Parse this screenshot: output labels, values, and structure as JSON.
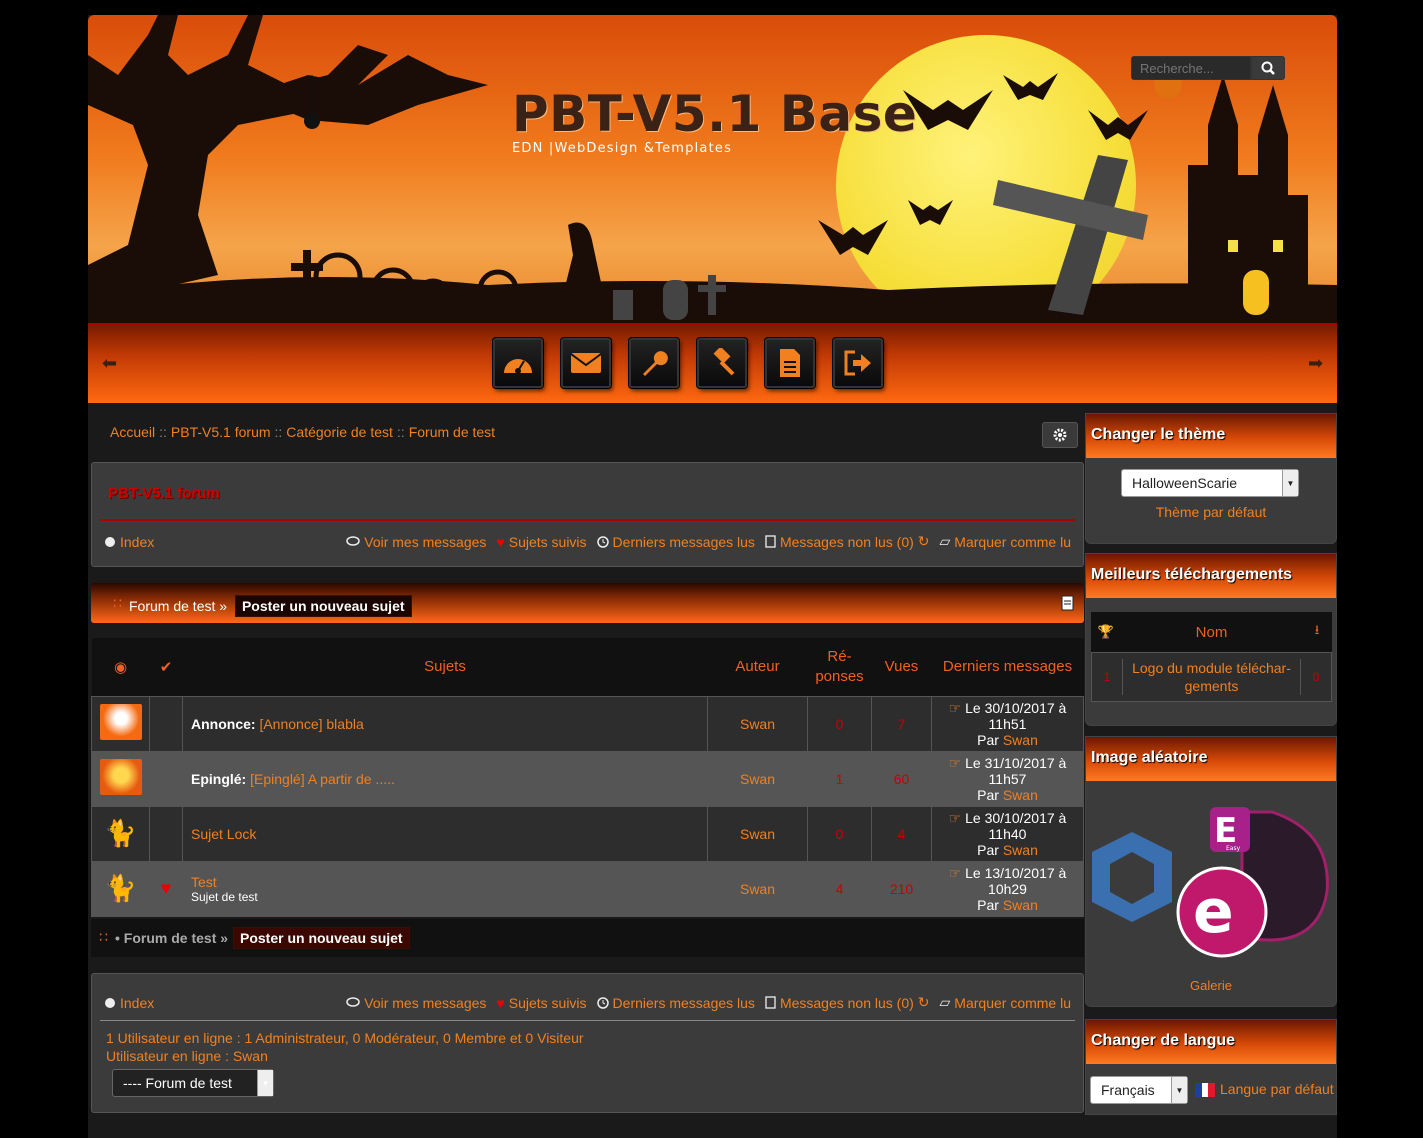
{
  "header": {
    "title": "PBT-V5.1 Base",
    "subtitle": "EDN |WebDesign &Templates",
    "search_placeholder": "Recherche..."
  },
  "nav": {
    "buttons": [
      "dashboard-icon",
      "envelope-icon",
      "wrench-icon",
      "gavel-icon",
      "document-icon",
      "logout-icon"
    ]
  },
  "breadcrumb": {
    "items": [
      "Accueil",
      "PBT-V5.1 forum",
      "Catégorie de test",
      "Forum de test"
    ],
    "separator": "::"
  },
  "forum": {
    "title": "PBT-V5.1 forum",
    "quicklinks": {
      "index": "Index",
      "my_messages": "Voir mes messages",
      "followed": "Sujets suivis",
      "last_read": "Derniers messages lus",
      "unread": "Messages non lus (0)",
      "mark_read": "Marquer comme lu"
    }
  },
  "topic_bar": {
    "forum_name": "Forum de test »",
    "post_button": "Poster un nouveau sujet",
    "footer_forum_name": "• Forum de test »"
  },
  "table": {
    "headers": {
      "subjects": "Sujets",
      "author": "Auteur",
      "replies": "Ré-\nponses",
      "views": "Vues",
      "last": "Derniers messages"
    },
    "rows": [
      {
        "prefix": "Annonce:",
        "title": "[Annonce] blabla",
        "desc": "",
        "author": "Swan",
        "replies": "0",
        "views": "7",
        "date": "Le 30/10/2017 à 11h51",
        "by_label": "Par",
        "by": "Swan",
        "followed": false
      },
      {
        "prefix": "Epinglé:",
        "title": "[Epinglé] A partir de .....",
        "desc": "",
        "author": "Swan",
        "replies": "1",
        "views": "60",
        "date": "Le 31/10/2017 à 11h57",
        "by_label": "Par",
        "by": "Swan",
        "followed": false
      },
      {
        "prefix": "",
        "title": "Sujet Lock",
        "desc": "",
        "author": "Swan",
        "replies": "0",
        "views": "4",
        "date": "Le 30/10/2017 à 11h40",
        "by_label": "Par",
        "by": "Swan",
        "followed": false
      },
      {
        "prefix": "",
        "title": "Test",
        "desc": "Sujet de test",
        "author": "Swan",
        "replies": "4",
        "views": "210",
        "date": "Le 13/10/2017 à 10h29",
        "by_label": "Par",
        "by": "Swan",
        "followed": true
      }
    ]
  },
  "online": {
    "line1": "1 Utilisateur en ligne : 1 Administrateur, 0 Modérateur, 0 Membre et 0 Visiteur",
    "line2": "Utilisateur en ligne : Swan",
    "jump_select": "---- Forum de test"
  },
  "sidebar": {
    "theme": {
      "title": "Changer le thème",
      "select": "HalloweenScarie",
      "default_link": "Thème par défaut"
    },
    "downloads": {
      "title": "Meilleurs téléchargements",
      "col_name": "Nom",
      "row": {
        "rank": "1",
        "name": "Logo du module téléchar-\ngements",
        "count": "0"
      }
    },
    "random_image": {
      "title": "Image aléatoire",
      "caption": "Galerie",
      "logo_label": "Easy"
    },
    "language": {
      "title": "Changer de langue",
      "select": "Français",
      "default_link": "Langue par défaut"
    }
  },
  "colors": {
    "accent": "#f08020",
    "red": "#cc0000",
    "panel": "#3b3b3b"
  }
}
